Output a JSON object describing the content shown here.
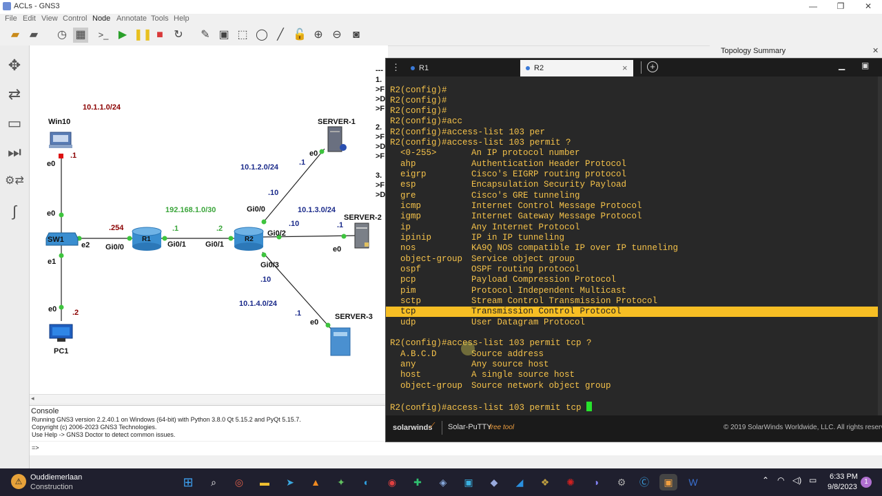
{
  "window": {
    "title": "ACLs - GNS3",
    "min": "—",
    "max": "❐",
    "close": "✕"
  },
  "menu": [
    "File",
    "Edit",
    "View",
    "Control",
    "Node",
    "Annotate",
    "Tools",
    "Help"
  ],
  "topology": {
    "networks": {
      "n1": "10.1.1.0/24",
      "n2": "10.1.2.0/24",
      "n3": "10.1.3.0/24",
      "n4": "10.1.4.0/24",
      "core": "192.168.1.0/30"
    },
    "nodes": {
      "win10": "Win10",
      "pc1": "PC1",
      "sw1": "SW1",
      "r1": "R1",
      "r2": "R2",
      "server1": "SERVER-1",
      "server2": "SERVER-2",
      "server3": "SERVER-3"
    },
    "ports": {
      "win_e0": "e0",
      "win_ip": ".1",
      "sw_e0": "e0",
      "sw_e1": "e1",
      "sw_e2": "e2",
      "pc_e0": "e0",
      "pc_ip": ".2",
      "r1_g00": "Gi0/0",
      "r1_g01": "Gi0/1",
      "r1_ip_left": ".254",
      "r1_ip_right": ".1",
      "r2_ip_left": ".2",
      "r2_g01": "Gi0/1",
      "r2_g00": "Gi0/0",
      "r2_g02": "Gi0/2",
      "r2_g03": "Gi0/3",
      "r2_ip_up": ".10",
      "r2_ip_right": ".10",
      "r2_ip_down": ".10",
      "s1_ip": ".1",
      "s1_e0": "e0",
      "s2_ip": ".1",
      "s2_e0": "e0",
      "s3_ip": ".1",
      "s3_e0": "e0"
    }
  },
  "partial_text": [
    "---",
    "1.",
    ">F",
    ">D",
    ">F",
    "2.",
    ">F",
    ">D",
    ">F",
    "3.",
    ">F",
    ">D"
  ],
  "topology_summary": "Topology Summary",
  "console": {
    "title": "Console",
    "lines": [
      "Running GNS3 version 2.2.40.1 on Windows (64-bit) with Python 3.8.0 Qt 5.15.2 and PyQt 5.15.7.",
      "Copyright (c) 2006-2023 GNS3 Technologies.",
      "Use Help -> GNS3 Doctor to detect common issues."
    ],
    "prompt": "=>"
  },
  "terminal": {
    "tabs": [
      {
        "label": "R1",
        "active": false
      },
      {
        "label": "R2",
        "active": true
      }
    ],
    "tab_close": "×",
    "add_tab": "+",
    "lines_top": [
      "R2(config)#",
      "R2(config)#",
      "R2(config)#",
      "R2(config)#acc",
      "R2(config)#access-list 103 per",
      "R2(config)#access-list 103 permit ?"
    ],
    "protocols": [
      {
        "k": "<0-255>",
        "d": "An IP protocol number"
      },
      {
        "k": "ahp",
        "d": "Authentication Header Protocol"
      },
      {
        "k": "eigrp",
        "d": "Cisco's EIGRP routing protocol"
      },
      {
        "k": "esp",
        "d": "Encapsulation Security Payload"
      },
      {
        "k": "gre",
        "d": "Cisco's GRE tunneling"
      },
      {
        "k": "icmp",
        "d": "Internet Control Message Protocol"
      },
      {
        "k": "igmp",
        "d": "Internet Gateway Message Protocol"
      },
      {
        "k": "ip",
        "d": "Any Internet Protocol"
      },
      {
        "k": "ipinip",
        "d": "IP in IP tunneling"
      },
      {
        "k": "nos",
        "d": "KA9Q NOS compatible IP over IP tunneling"
      },
      {
        "k": "object-group",
        "d": "Service object group"
      },
      {
        "k": "ospf",
        "d": "OSPF routing protocol"
      },
      {
        "k": "pcp",
        "d": "Payload Compression Protocol"
      },
      {
        "k": "pim",
        "d": "Protocol Independent Multicast"
      },
      {
        "k": "sctp",
        "d": "Stream Control Transmission Protocol"
      },
      {
        "k": "tcp",
        "d": "Transmission Control Protocol"
      },
      {
        "k": "udp",
        "d": "User Datagram Protocol"
      }
    ],
    "highlighted": "tcp",
    "cmd2": "R2(config)#access-list 103 permit tcp ?",
    "sources": [
      {
        "k": "A.B.C.D",
        "d": "Source address"
      },
      {
        "k": "any",
        "d": "Any source host"
      },
      {
        "k": "host",
        "d": "A single source host"
      },
      {
        "k": "object-group",
        "d": "Source network object group"
      }
    ],
    "current": "R2(config)#access-list 103 permit tcp ",
    "footer_brand": "solarwinds",
    "footer_app": "Solar-PuTTY",
    "footer_free": "free tool",
    "footer_copy": "© 2019 SolarWinds Worldwide, LLC. All rights reserv"
  },
  "taskbar": {
    "weather_title": "Ouddiemerlaan",
    "weather_sub": "Construction",
    "time": "6:33 PM",
    "date": "9/8/2023",
    "notif": "1"
  },
  "colors": {
    "accent_yellow": "#f6be24",
    "term_text": "#f5c24a",
    "link_green": "#3ec43e"
  }
}
